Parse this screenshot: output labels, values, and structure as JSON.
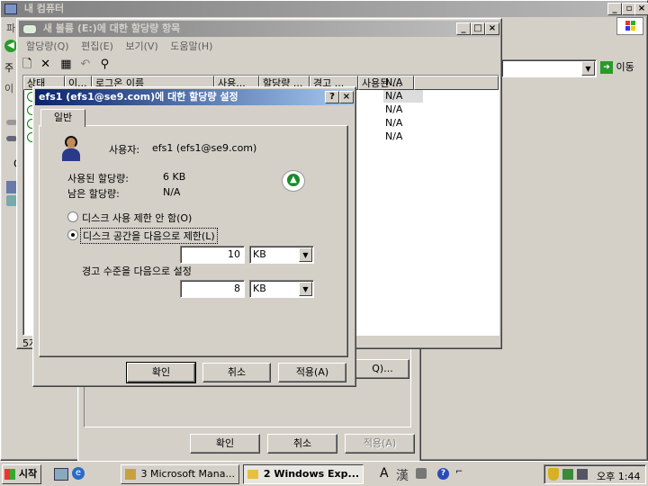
{
  "background_window": {
    "title": "내 컴퓨터",
    "menu_first_char": "파",
    "address_label_char": "주",
    "go_label": "이동",
    "side_letter": "C",
    "side_prefix": "이"
  },
  "behind_dialog": {
    "buttons": {
      "ok": "확인",
      "cancel": "취소",
      "apply": "적용(A)"
    },
    "partial_button": "Q)..."
  },
  "quota_window": {
    "title": "새 볼륨 (E:)에 대한 할당량 항목",
    "menu": [
      "할당량(Q)",
      "편집(E)",
      "보기(V)",
      "도움말(H)"
    ],
    "columns": [
      "상태",
      "이...",
      "로그온 이름",
      "사용...",
      "할당량 ...",
      "경고 ...",
      "사용된 ..."
    ],
    "rows_used": [
      "N/A",
      "N/A",
      "N/A",
      "N/A",
      "N/A"
    ],
    "status_partial": "5개"
  },
  "settings_dialog": {
    "title": "efs1 (efs1@se9.com)에 대한 할당량 설정",
    "help_btn": "?",
    "close_btn": "×",
    "tab": "일반",
    "user_label": "사용자:",
    "user_value": "efs1 (efs1@se9.com)",
    "used_label": "사용된 할당량:",
    "used_value": "6 KB",
    "remaining_label": "남은 할당량:",
    "remaining_value": "N/A",
    "radio_no_limit": "디스크 사용 제한 안 함(O)",
    "radio_limit": "디스크 공간을 다음으로 제한(L)",
    "limit_value": "10",
    "limit_unit": "KB",
    "warning_label": "경고 수준을 다음으로 설정",
    "warning_value": "8",
    "warning_unit": "KB",
    "buttons": {
      "ok": "확인",
      "cancel": "취소",
      "apply": "적용(A)"
    }
  },
  "taskbar": {
    "start": "시작",
    "tasks": [
      "3 Microsoft Mana...",
      "2 Windows Exp..."
    ],
    "ime_a": "A",
    "ime_han": "漢",
    "clock": "오후 1:44"
  }
}
